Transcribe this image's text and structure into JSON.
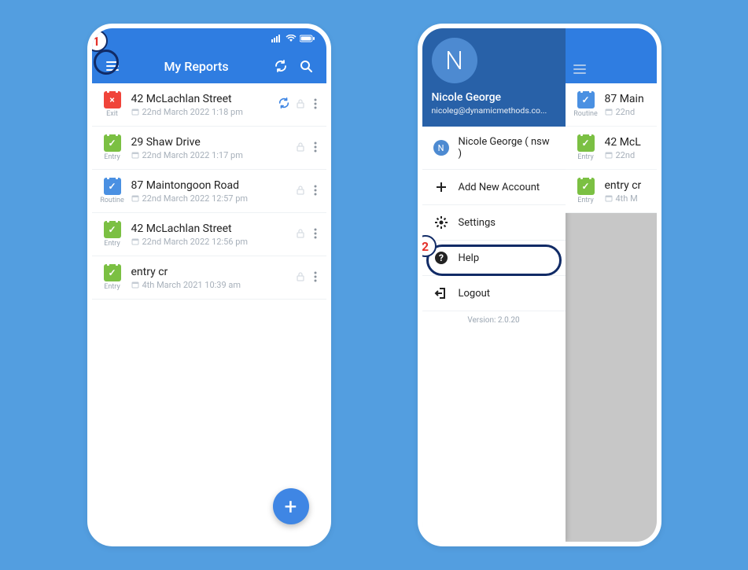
{
  "callouts": [
    "1",
    "2"
  ],
  "phoneA": {
    "appbar_title": "My Reports",
    "rows": [
      {
        "tag": "Exit",
        "tagcolor": "cal-red",
        "mark": "×",
        "title": "42 McLachlan Street",
        "date": "22nd March 2022 1:18 pm",
        "syncing": true
      },
      {
        "tag": "Entry",
        "tagcolor": "cal-green",
        "mark": "✓",
        "title": "29 Shaw Drive",
        "date": "22nd March 2022 1:17 pm",
        "syncing": false
      },
      {
        "tag": "Routine",
        "tagcolor": "cal-blue",
        "mark": "✓",
        "title": "87 Maintongoon Road",
        "date": "22nd March 2022 12:57 pm",
        "syncing": false
      },
      {
        "tag": "Entry",
        "tagcolor": "cal-green",
        "mark": "✓",
        "title": "42 McLachlan Street",
        "date": "22nd March 2022 12:56 pm",
        "syncing": false
      },
      {
        "tag": "Entry",
        "tagcolor": "cal-green",
        "mark": "✓",
        "title": "entry cr",
        "date": "4th March 2021 10:39 am",
        "syncing": false
      }
    ]
  },
  "phoneB": {
    "profile_initial": "N",
    "profile_name": "Nicole George",
    "profile_email": "nicoleg@dynamicmethods.co...",
    "menu": {
      "account_label": "Nicole George ( nsw )",
      "add_account_label": "Add New Account",
      "settings_label": "Settings",
      "help_label": "Help",
      "logout_label": "Logout"
    },
    "version": "Version: 2.0.20",
    "dim_rows": [
      {
        "tag": "Routine",
        "tagcolor": "cal-blue",
        "mark": "✓",
        "title": "87 Main",
        "date": "22nd"
      },
      {
        "tag": "Entry",
        "tagcolor": "cal-green",
        "mark": "✓",
        "title": "42 McL",
        "date": "22nd"
      },
      {
        "tag": "Entry",
        "tagcolor": "cal-green",
        "mark": "✓",
        "title": "entry cr",
        "date": "4th M"
      }
    ]
  }
}
